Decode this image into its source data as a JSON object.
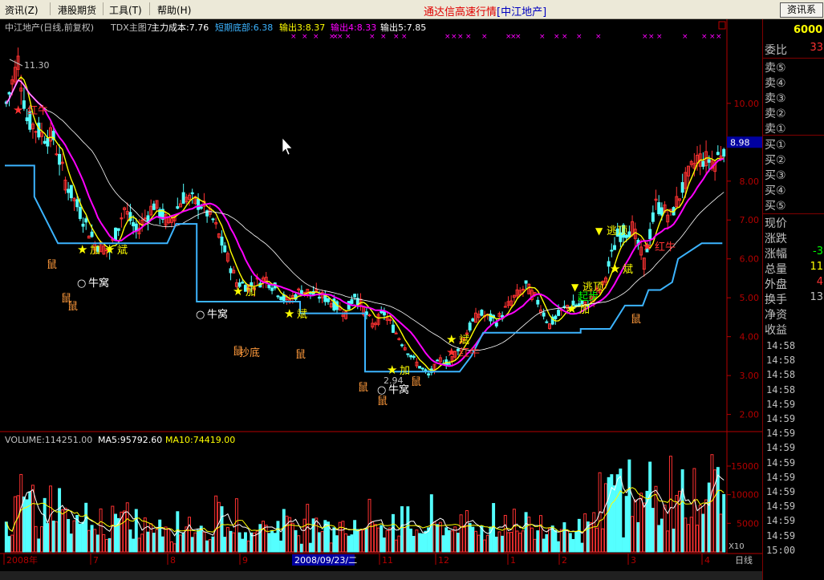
{
  "menu": {
    "items": [
      {
        "label": "资讯(Z)"
      },
      {
        "label": "港股期货"
      },
      {
        "label": "工具(T)"
      },
      {
        "label": "帮助(H)"
      }
    ],
    "app_title": "通达信高速行情",
    "stock_title": "[中江地产]",
    "info_button": "资讯系"
  },
  "main_header": {
    "name": "中江地产(日线,前复权)",
    "indicator": "TDX主图7",
    "main_cost": "主力成本:7.76",
    "short_bottom": "短期底部:6.38",
    "out3": "输出3:8.37",
    "out4": "输出4:8.33",
    "out5": "输出5:7.85"
  },
  "price_axis": {
    "labels": [
      "10.00",
      "9.00",
      "8.00",
      "7.00",
      "6.00",
      "5.00",
      "4.00",
      "3.00",
      "2.00"
    ],
    "current": "8.98"
  },
  "volume_header": {
    "volume": "VOLUME:114251.00",
    "ma5": "MA5:95792.60",
    "ma10": "MA10:74419.00"
  },
  "volume_axis": {
    "labels": [
      "15000",
      "10000",
      "5000"
    ],
    "unit": "X10"
  },
  "x_axis": {
    "labels": [
      "2008年",
      "7",
      "8",
      "9",
      "11",
      "12",
      "1",
      "2",
      "3",
      "4"
    ],
    "cursor_date": "2008/09/23/二",
    "period": "日线"
  },
  "annotations": {
    "high": "11.30",
    "low": "2.94",
    "hongniu": "红牛",
    "jia": "加",
    "bin": "斌",
    "niuwo": "牛窝",
    "shu": "鼠",
    "chaodi": "抄底",
    "taoding": "逃顶",
    "qibu": "起步"
  },
  "side_panel": {
    "weibi": {
      "label": "委比",
      "value": "33"
    },
    "top_value": "6000",
    "sell": [
      "卖⑤",
      "卖④",
      "卖③",
      "卖②",
      "卖①"
    ],
    "buy": [
      "买①",
      "买②",
      "买③",
      "买④",
      "买⑤"
    ],
    "stats": [
      {
        "label": "现价",
        "value": ""
      },
      {
        "label": "涨跌",
        "value": ""
      },
      {
        "label": "涨幅",
        "value": "-3"
      },
      {
        "label": "总量",
        "value": "11"
      },
      {
        "label": "外盘",
        "value": "4"
      },
      {
        "label": "换手",
        "value": "13"
      },
      {
        "label": "净资",
        "value": ""
      },
      {
        "label": "收益",
        "value": ""
      }
    ],
    "times": [
      "14:58",
      "14:58",
      "14:58",
      "14:58",
      "14:59",
      "14:59",
      "14:59",
      "14:59",
      "14:59",
      "14:59",
      "14:59",
      "14:59",
      "14:59",
      "14:59",
      "15:00"
    ]
  },
  "colors": {
    "up": "#ff3232",
    "down": "#54ffff",
    "ma_magenta": "#ff00ff",
    "ma_yellow": "#ffff00",
    "support_blue": "#3cb4ff",
    "axis_red": "#b40000"
  }
}
